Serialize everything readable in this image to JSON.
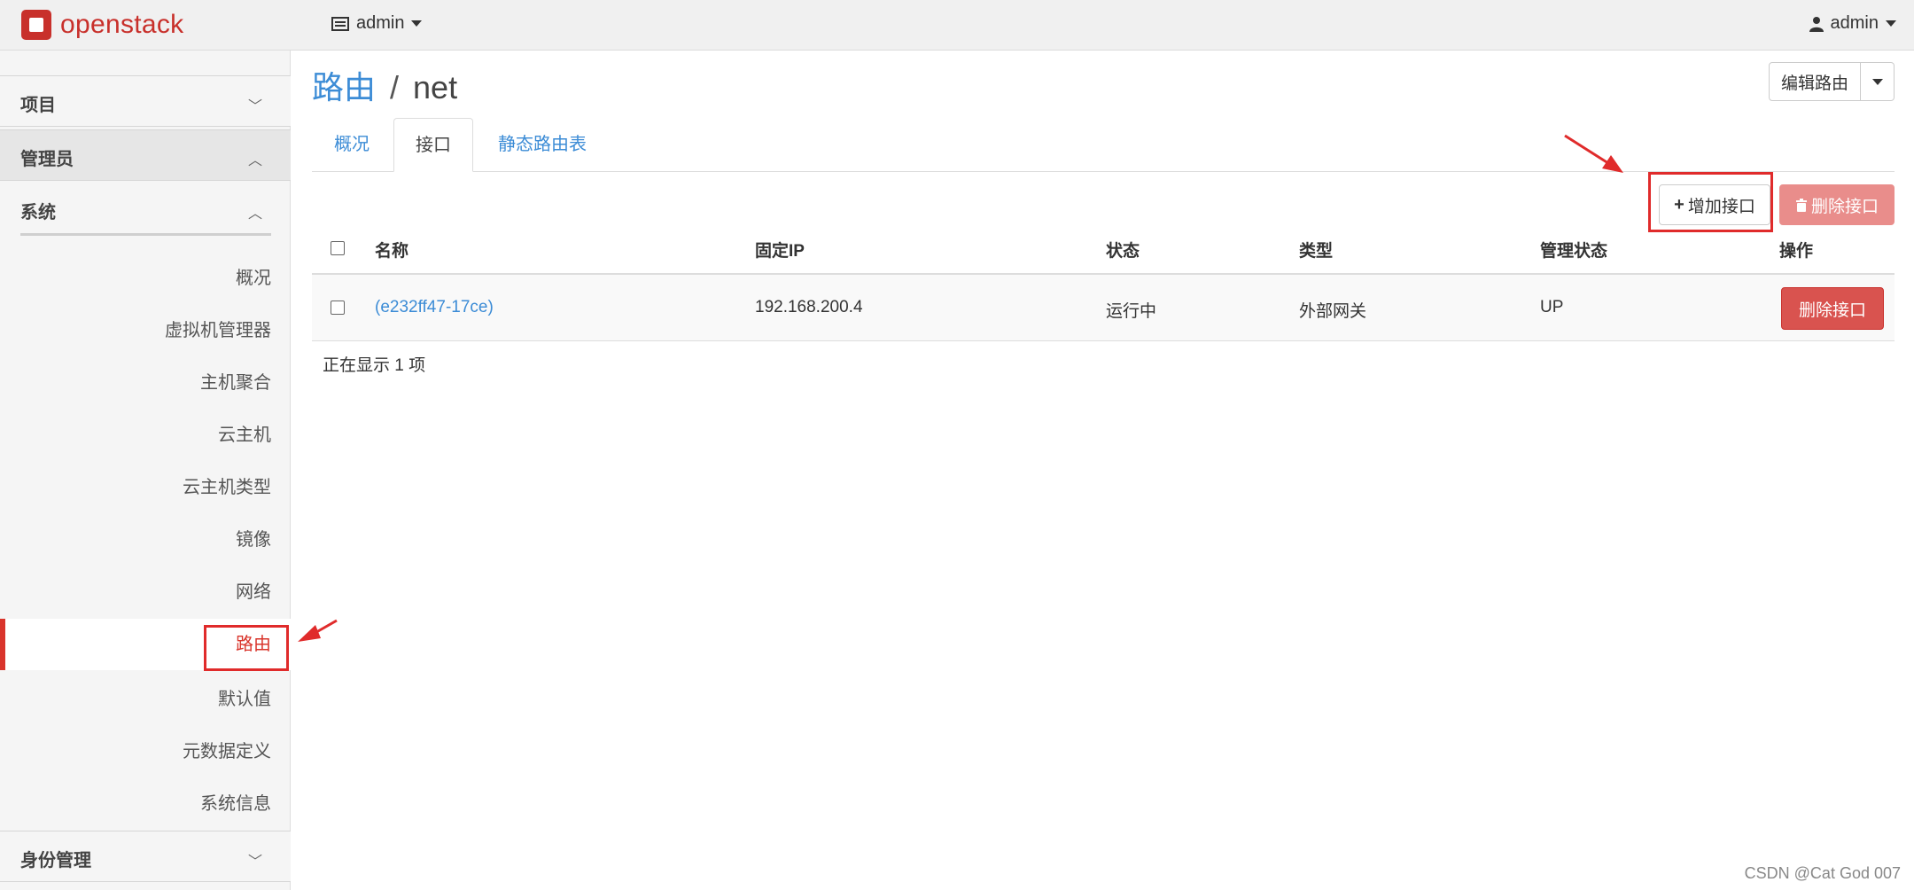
{
  "topbar": {
    "logo_text_open": "open",
    "logo_text_stack": "stack",
    "project": "admin",
    "user": "admin"
  },
  "sidebar": {
    "project": "项目",
    "admin": "管理员",
    "system": "系统",
    "items": [
      "概况",
      "虚拟机管理器",
      "主机聚合",
      "云主机",
      "云主机类型",
      "镜像",
      "网络",
      "路由",
      "默认值",
      "元数据定义",
      "系统信息"
    ],
    "active": "路由",
    "identity": "身份管理"
  },
  "header": {
    "breadcrumb": "路由",
    "separator": "/",
    "current": "net",
    "edit_button": "编辑路由"
  },
  "tabs": [
    "概况",
    "接口",
    "静态路由表"
  ],
  "actions": {
    "add": "增加接口",
    "delete": "删除接口"
  },
  "table": {
    "columns": [
      "名称",
      "固定IP",
      "状态",
      "类型",
      "管理状态",
      "操作"
    ],
    "rows": [
      {
        "name": "(e232ff47-17ce)",
        "ip": "192.168.200.4",
        "status": "运行中",
        "type": "外部网关",
        "admin_state": "UP",
        "action": "删除接口"
      }
    ],
    "count_text": "正在显示 1 项"
  },
  "watermark": "CSDN @Cat God 007",
  "colors": {
    "accent": "#3c8cd6",
    "danger": "#d9534f",
    "brand": "#c8302b",
    "highlight": "#e02b2b"
  }
}
